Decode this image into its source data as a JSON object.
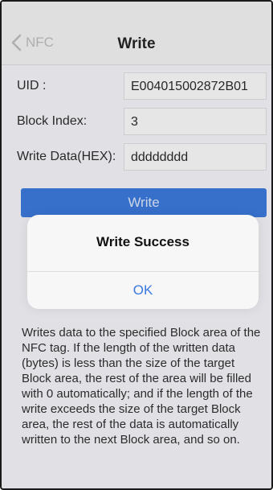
{
  "navbar": {
    "back_label": "NFC",
    "title": "Write"
  },
  "form": {
    "uid_label": "UID :",
    "uid_value": "E004015002872B01",
    "block_label": "Block Index:",
    "block_value": "3",
    "data_label": "Write Data(HEX):",
    "data_value": "dddddddd"
  },
  "write_button_label": "Write",
  "alert": {
    "title": "Write Success",
    "ok_label": "OK"
  },
  "description": "Writes data to the specified Block area of the NFC tag. If the length of the written data (bytes) is less than the size of the target Block area, the rest of the area will be filled with 0 automatically; and if the length of the write exceeds the size of the target Block area, the rest of the data is automatically written to the next Block area, and so on.",
  "colors": {
    "accent": "#2e6fd6",
    "link": "#3a78e0"
  },
  "icons": {
    "back": "chevron-left-icon"
  }
}
